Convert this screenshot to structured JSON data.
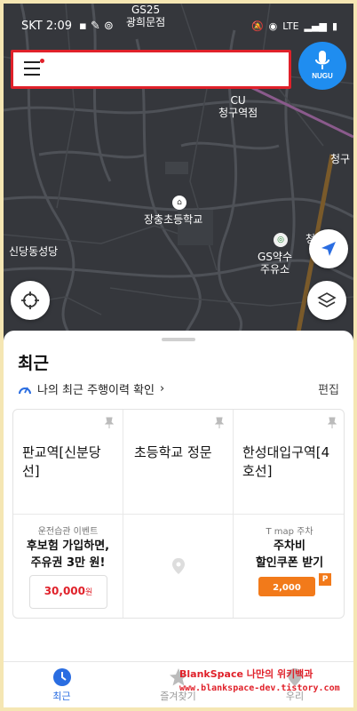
{
  "status_bar": {
    "carrier_time": "SKT 2:09",
    "network": "LTE"
  },
  "search": {
    "menu_icon": "hamburger-menu-icon"
  },
  "nugu_button": {
    "label": "NUGU",
    "icon": "microphone-icon"
  },
  "map": {
    "labels": {
      "top_partial": "GS25\n광희문점",
      "cu": "CU\n청구역점",
      "right_edge": "청구",
      "school": "장충초등학교",
      "church": "신당동성당",
      "gs_station": "GS약수\n주유소",
      "small_right": "청"
    }
  },
  "sheet": {
    "title": "최근",
    "history_link": "나의 최근 주행이력 확인",
    "edit": "편집",
    "places": [
      {
        "name": "판교역[신분당선]"
      },
      {
        "name": "초등학교 정문"
      },
      {
        "name": "한성대입구역[4호선]"
      }
    ],
    "promos": [
      {
        "subtitle": "운전습관 이벤트",
        "title": "후보험 가입하면,\n주유권 3만 원!",
        "coupon_value": "30,000",
        "coupon_unit": "원"
      },
      {
        "subtitle": "",
        "title": ""
      },
      {
        "subtitle": "T map 주차",
        "title": "주차비\n할인쿠폰 받기",
        "coupon_value": "2,000"
      }
    ]
  },
  "bottom_nav": {
    "items": [
      {
        "label": "최근",
        "icon": "clock-icon",
        "active": true
      },
      {
        "label": "즐겨찾기",
        "icon": "star-icon",
        "active": false
      },
      {
        "label": "우리",
        "icon": "pin-icon",
        "active": false
      }
    ]
  },
  "watermark": {
    "line1": "BlankSpace 나만의 위키백과",
    "line2": "www.blankspace-dev.tistory.com"
  },
  "colors": {
    "accent": "#1f8df0",
    "highlight_border": "#e0212a",
    "map_bg": "#35373c",
    "active_tab": "#2a6de1"
  }
}
